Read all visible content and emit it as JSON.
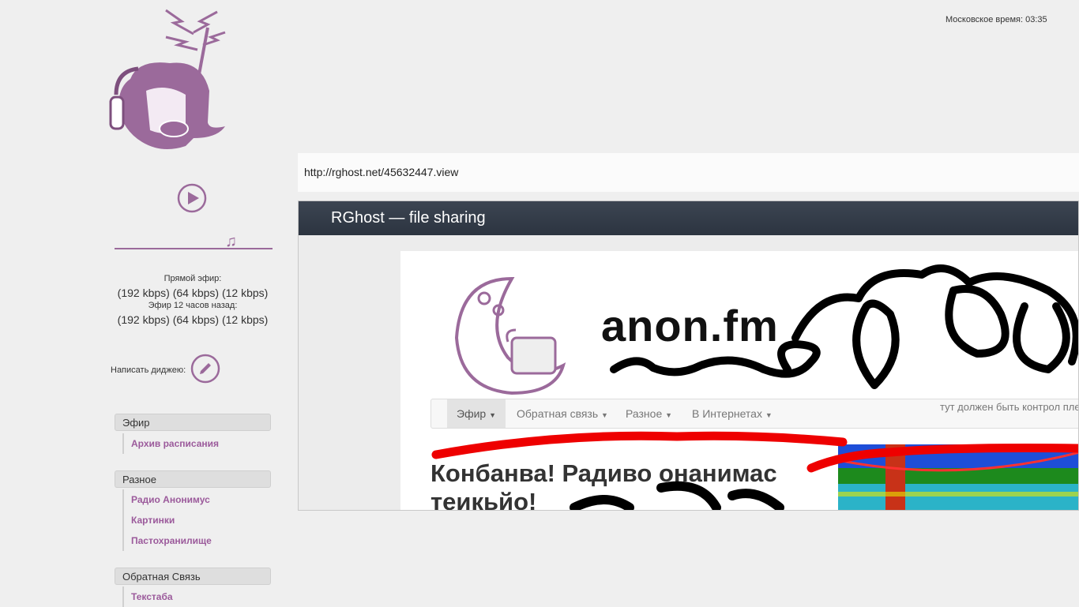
{
  "header": {
    "moscow_time": "Московское время: 03:35"
  },
  "stream": {
    "live_label": "Прямой эфир:",
    "live_links": [
      "(192 kbps)",
      "(64 kbps)",
      "(12 kbps)"
    ],
    "past_label": "Эфир 12 часов назад:",
    "past_links": [
      "(192 kbps)",
      "(64 kbps)",
      "(12 kbps)"
    ]
  },
  "write_dj": {
    "label": "Написать диджею:"
  },
  "menu": [
    {
      "title": "Эфир",
      "items": [
        "Архив расписания"
      ]
    },
    {
      "title": "Разное",
      "items": [
        "Радио Анонимус",
        "Картинки",
        "Пастохранилище"
      ]
    },
    {
      "title": "Обратная Связь",
      "items": [
        "Текстаба"
      ]
    }
  ],
  "content": {
    "url": "http://rghost.net/45632447.view",
    "preview_title": "RGhost — file sharing",
    "shot": {
      "site_title": "anon.fm",
      "nav_tabs": [
        "Эфир",
        "Обратная связь",
        "Разное",
        "В Интернетах"
      ],
      "player_note": "тут должен быть контрол пле",
      "headline_line1": "Конбанва! Радиво онанимас",
      "headline_line2": "теикьйо!"
    }
  },
  "colors": {
    "accent": "#9b5a9b",
    "background": "#efefef",
    "preview_header": "#323a46"
  }
}
